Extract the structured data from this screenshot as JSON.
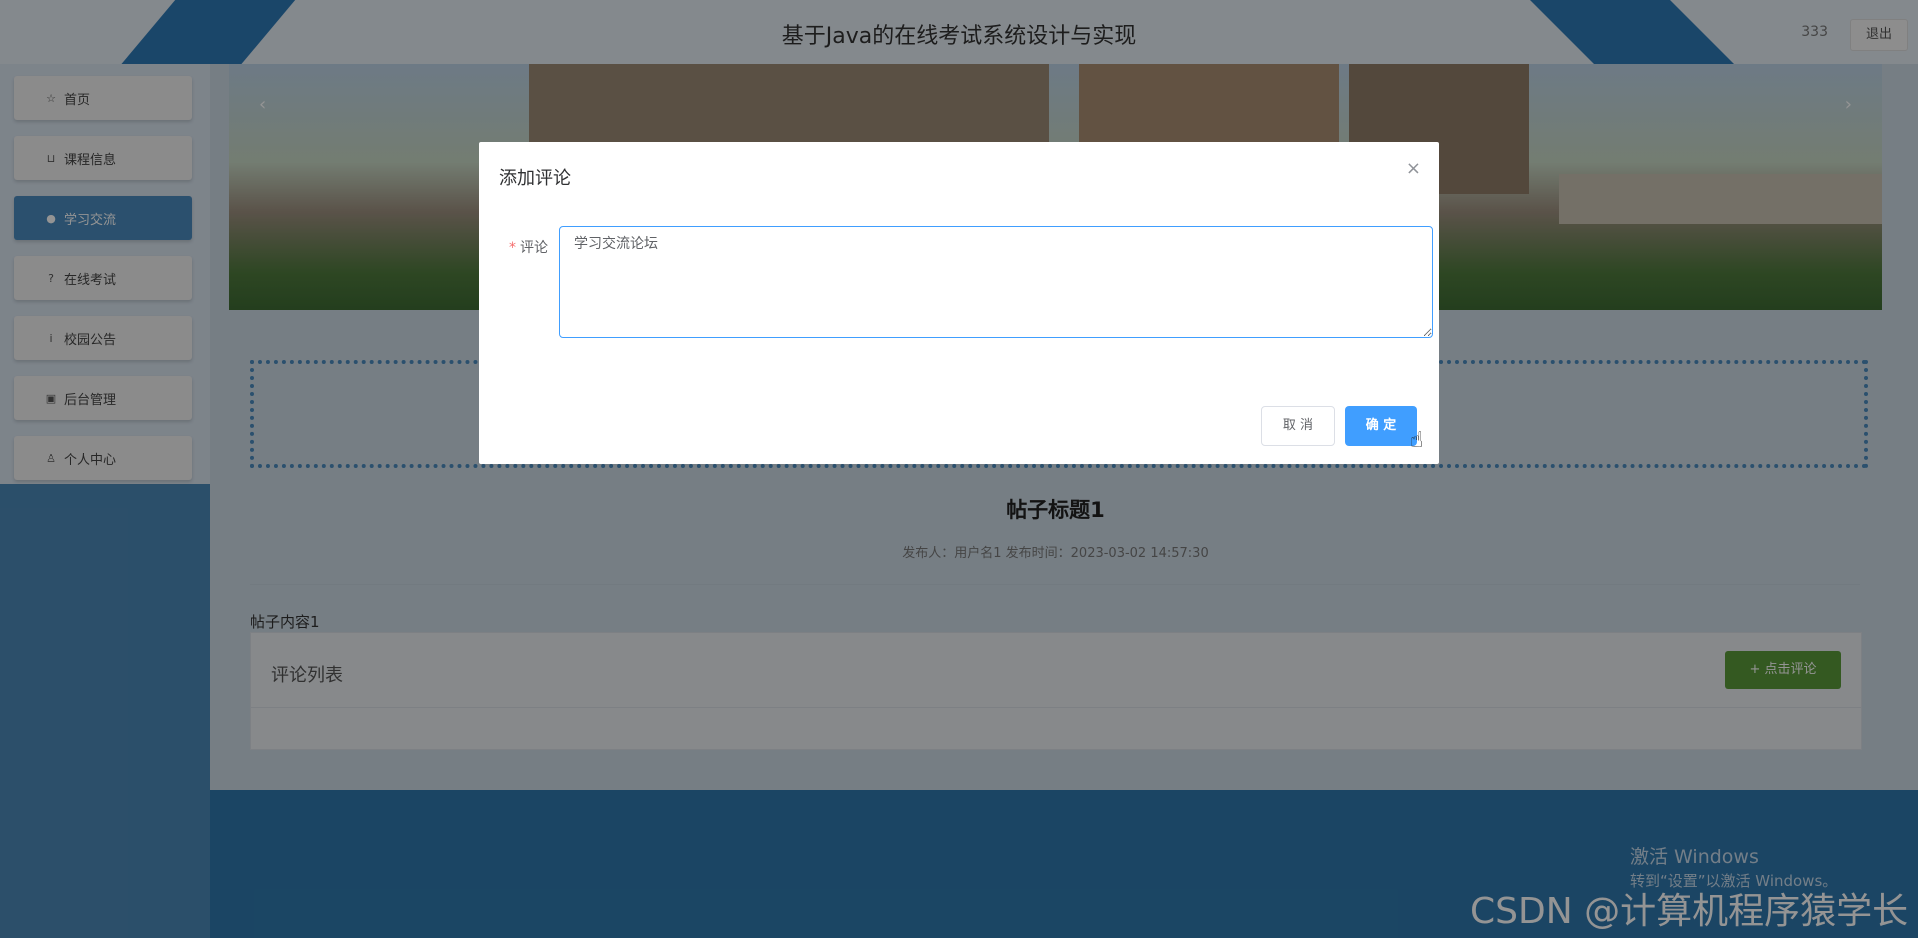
{
  "header": {
    "title": "基于Java的在线考试系统设计与实现",
    "username": "333",
    "logout_label": "退出"
  },
  "sidebar": {
    "items": [
      {
        "label": "首页",
        "icon": "star-icon",
        "glyph": "☆"
      },
      {
        "label": "课程信息",
        "icon": "bag-icon",
        "glyph": "⊔"
      },
      {
        "label": "学习交流",
        "icon": "info-circle-icon",
        "glyph": "●"
      },
      {
        "label": "在线考试",
        "icon": "question-circle-icon",
        "glyph": "?"
      },
      {
        "label": "校园公告",
        "icon": "info-icon",
        "glyph": "i"
      },
      {
        "label": "后台管理",
        "icon": "briefcase-icon",
        "glyph": "▣"
      },
      {
        "label": "个人中心",
        "icon": "user-icon",
        "glyph": "♙"
      }
    ],
    "active_index": 2
  },
  "banner": {
    "prev_glyph": "‹",
    "next_glyph": "›"
  },
  "post": {
    "title": "帖子标题1",
    "meta": "发布人：用户名1  发布时间：2023-03-02 14:57:30",
    "content": "帖子内容1"
  },
  "comments": {
    "header": "评论列表",
    "add_label": "+ 点击评论"
  },
  "modal": {
    "title": "添加评论",
    "close_glyph": "×",
    "field_label": "评论",
    "required_mark": "*",
    "field_value": "学习交流论坛",
    "cancel_label": "取 消",
    "confirm_label": "确 定"
  },
  "watermark": {
    "line1": "激活 Windows",
    "line2": "转到“设置”以激活 Windows。",
    "csdn": "CSDN @计算机程序猿学长"
  },
  "colors": {
    "primary": "#409eff",
    "nav_active": "#4a8bbd",
    "comment_button": "#5a9a3a",
    "footer": "#2f78ad"
  }
}
